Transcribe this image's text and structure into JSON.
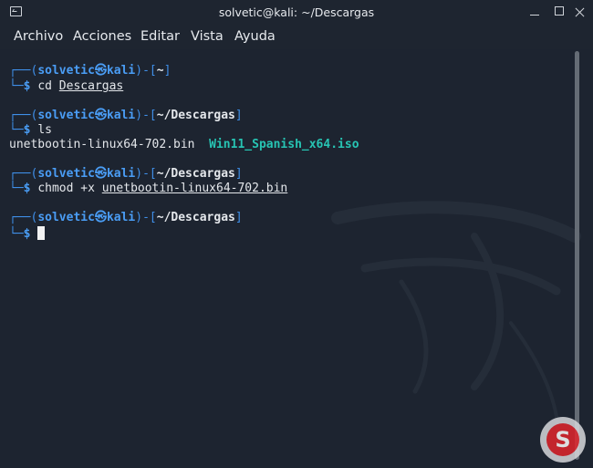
{
  "window": {
    "title": "solvetic@kali: ~/Descargas"
  },
  "menu": [
    "Archivo",
    "Acciones",
    "Editar",
    "Vista",
    "Ayuda"
  ],
  "prompts": [
    {
      "corner_top": "┌──(",
      "user": "solvetic",
      "at": "㉿",
      "host": "kali",
      "bracket_mid": ")-[",
      "path": "~",
      "bracket_end": "]",
      "corner_bottom": "└─",
      "dollar": "$",
      "cmd": "cd",
      "arg": "Descargas"
    },
    {
      "corner_top": "┌──(",
      "user": "solvetic",
      "at": "㉿",
      "host": "kali",
      "bracket_mid": ")-[",
      "path": "~/Descargas",
      "bracket_end": "]",
      "corner_bottom": "└─",
      "dollar": "$",
      "cmd": "ls",
      "arg": ""
    },
    {
      "corner_top": "┌──(",
      "user": "solvetic",
      "at": "㉿",
      "host": "kali",
      "bracket_mid": ")-[",
      "path": "~/Descargas",
      "bracket_end": "]",
      "corner_bottom": "└─",
      "dollar": "$",
      "cmd": "chmod +x",
      "arg": "unetbootin-linux64-702.bin"
    },
    {
      "corner_top": "┌──(",
      "user": "solvetic",
      "at": "㉿",
      "host": "kali",
      "bracket_mid": ")-[",
      "path": "~/Descargas",
      "bracket_end": "]",
      "corner_bottom": "└─",
      "dollar": "$",
      "cmd": "",
      "arg": ""
    }
  ],
  "ls_output": {
    "file1": "unetbootin-linux64-702.bin",
    "file2": "Win11_Spanish_x64.iso"
  },
  "watermark": {
    "letter": "S"
  },
  "colors": {
    "background": "#1d2430",
    "prompt_blue": "#3f8fe8",
    "iso_teal": "#27c4b3"
  }
}
